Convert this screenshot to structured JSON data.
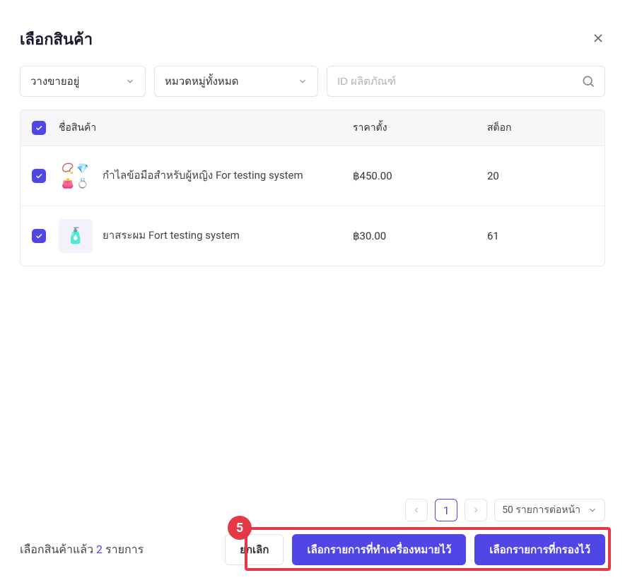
{
  "header": {
    "title": "เลือกสินค้า"
  },
  "filters": {
    "status_label": "วางขายอยู่",
    "category_label": "หมวดหมู่ทั้งหมด",
    "search_placeholder": "ID ผลิตภัณฑ์"
  },
  "table": {
    "headers": {
      "name": "ชื่อสินค้า",
      "price": "ราคาตั้ง",
      "stock": "สต็อก"
    },
    "rows": [
      {
        "name": "กำไลข้อมือสำหรับผู้หญิง For testing system",
        "price": "฿450.00",
        "stock": "20"
      },
      {
        "name": "ยาสระผม Fort testing system",
        "price": "฿30.00",
        "stock": "61"
      }
    ]
  },
  "pager": {
    "current": "1",
    "page_size": "50 รายการต่อหน้า"
  },
  "footer": {
    "selected_prefix": "เลือกสินค้าแล้ว ",
    "selected_count": "2",
    "selected_suffix": " รายการ",
    "cancel": "ยกเลิก",
    "select_marked": "เลือกรายการที่ทำเครื่องหมายไว้",
    "select_filtered": "เลือกรายการที่กรองไว้"
  },
  "step_badge": "5"
}
